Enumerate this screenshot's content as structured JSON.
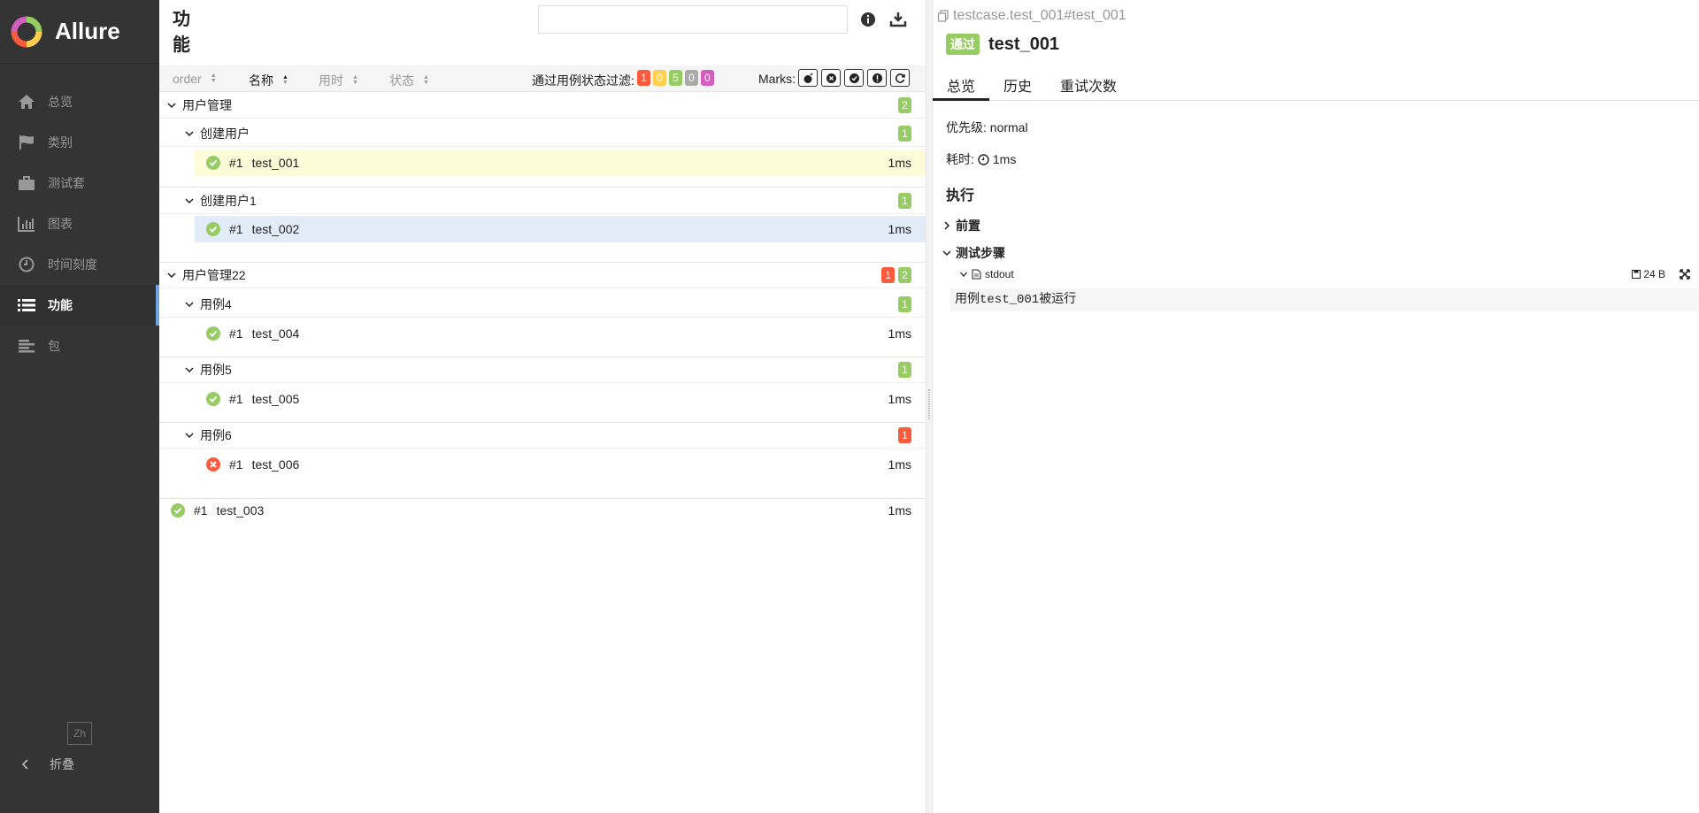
{
  "sidebar": {
    "brand": "Allure",
    "items": [
      {
        "label": "总览",
        "icon": "home-icon"
      },
      {
        "label": "类别",
        "icon": "flag-icon"
      },
      {
        "label": "测试套",
        "icon": "briefcase-icon"
      },
      {
        "label": "图表",
        "icon": "bar-chart-icon"
      },
      {
        "label": "时间刻度",
        "icon": "clock-icon"
      },
      {
        "label": "功能",
        "icon": "list-icon",
        "active": true
      },
      {
        "label": "包",
        "icon": "align-left-icon"
      }
    ],
    "language": "Zh",
    "collapse_label": "折叠"
  },
  "tree_pane": {
    "title": "功能",
    "search": {
      "value": "",
      "placeholder": ""
    },
    "sort_columns": [
      {
        "label": "order",
        "active": false
      },
      {
        "label": "名称",
        "active": true
      },
      {
        "label": "用时",
        "active": false
      },
      {
        "label": "状态",
        "active": false
      }
    ],
    "filter_label": "通过用例状态过滤:",
    "status_filters": [
      {
        "status": "failed",
        "count": "1",
        "color": "#fd5a3e"
      },
      {
        "status": "broken",
        "count": "0",
        "color": "#ffd050"
      },
      {
        "status": "passed",
        "count": "5",
        "color": "#97cc64"
      },
      {
        "status": "skipped",
        "count": "0",
        "color": "#aaaaaa"
      },
      {
        "status": "unknown",
        "count": "0",
        "color": "#d35ebe"
      }
    ],
    "marks_label": "Marks:",
    "groups": [
      {
        "name": "用户管理",
        "counts": [
          {
            "value": "2",
            "color": "#97cc64"
          }
        ],
        "subgroups": [
          {
            "name": "创建用户",
            "count": "1",
            "count_color": "#97cc64",
            "cases": [
              {
                "num": "#1",
                "name": "test_001",
                "duration": "1ms",
                "status": "passed",
                "state": "selected"
              }
            ]
          },
          {
            "name": "创建用户1",
            "count": "1",
            "count_color": "#97cc64",
            "cases": [
              {
                "num": "#1",
                "name": "test_002",
                "duration": "1ms",
                "status": "passed",
                "state": "highlighted"
              }
            ]
          }
        ]
      },
      {
        "name": "用户管理22",
        "counts": [
          {
            "value": "1",
            "color": "#fd5a3e"
          },
          {
            "value": "2",
            "color": "#97cc64"
          }
        ],
        "subgroups": [
          {
            "name": "用例4",
            "count": "1",
            "count_color": "#97cc64",
            "cases": [
              {
                "num": "#1",
                "name": "test_004",
                "duration": "1ms",
                "status": "passed"
              }
            ]
          },
          {
            "name": "用例5",
            "count": "1",
            "count_color": "#97cc64",
            "cases": [
              {
                "num": "#1",
                "name": "test_005",
                "duration": "1ms",
                "status": "passed"
              }
            ]
          },
          {
            "name": "用例6",
            "count": "1",
            "count_color": "#fd5a3e",
            "cases": [
              {
                "num": "#1",
                "name": "test_006",
                "duration": "1ms",
                "status": "failed"
              }
            ]
          }
        ]
      }
    ],
    "root_case": {
      "num": "#1",
      "name": "test_003",
      "duration": "1ms",
      "status": "passed"
    }
  },
  "detail": {
    "path": "testcase.test_001#test_001",
    "status_label": "通过",
    "title": "test_001",
    "tabs": [
      {
        "label": "总览",
        "active": true
      },
      {
        "label": "历史",
        "active": false
      },
      {
        "label": "重试次数",
        "active": false
      }
    ],
    "severity": "优先级: normal",
    "duration_label": "耗时:",
    "duration_value": "1ms",
    "execution_title": "执行",
    "setup_label": "前置",
    "steps_label": "测试步骤",
    "attachment": {
      "name": "stdout",
      "size": "24 B",
      "content": "用例test_001被运行"
    }
  }
}
